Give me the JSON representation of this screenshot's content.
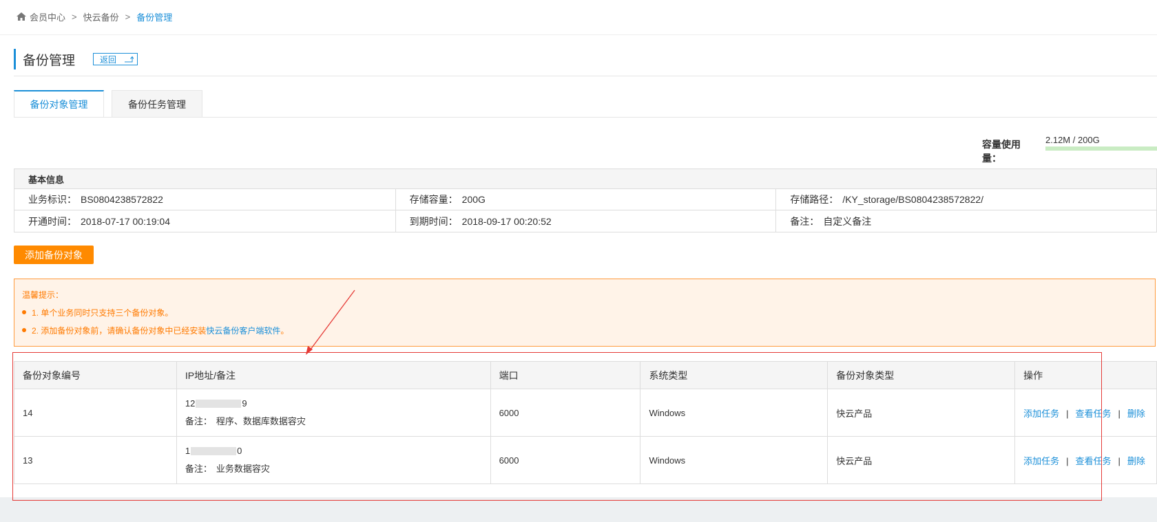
{
  "breadcrumb": {
    "items": [
      "会员中心",
      "快云备份",
      "备份管理"
    ],
    "separator": ">"
  },
  "page": {
    "title": "备份管理",
    "back_label": "返回"
  },
  "tabs": [
    {
      "label": "备份对象管理",
      "active": true
    },
    {
      "label": "备份任务管理",
      "active": false
    }
  ],
  "capacity": {
    "label": "容量使用量：",
    "value": "2.12M / 200G",
    "used_fraction": 0.0,
    "bar_color": "#c9ecc3"
  },
  "basic_info": {
    "header": "基本信息",
    "rows": [
      [
        {
          "key": "业务标识：",
          "value": "BS0804238572822"
        },
        {
          "key": "存储容量：",
          "value": "200G"
        },
        {
          "key": "存储路径：",
          "value": "/KY_storage/BS0804238572822/"
        }
      ],
      [
        {
          "key": "开通时间：",
          "value": "2018-07-17 00:19:04"
        },
        {
          "key": "到期时间：",
          "value": "2018-09-17 00:20:52"
        },
        {
          "key": "备注：",
          "value": "自定义备注"
        }
      ]
    ]
  },
  "add_button": {
    "label": "添加备份对象",
    "color": "#ff8a00"
  },
  "tips": {
    "title": "温馨提示：",
    "items": [
      {
        "text": "1. 单个业务同时只支持三个备份对象。",
        "link": ""
      },
      {
        "text": "2. 添加备份对象前，请确认备份对象中已经安装 ",
        "link": "快云备份客户端软件",
        "suffix": "。"
      }
    ]
  },
  "table": {
    "columns": [
      "备份对象编号",
      "IP地址/备注",
      "端口",
      "系统类型",
      "备份对象类型",
      "操作"
    ],
    "rows": [
      {
        "id": "14",
        "ip_prefix": "12",
        "ip_suffix": "9",
        "remark_label": "备注：",
        "remark": "程序、数据库数据容灾",
        "port": "6000",
        "os": "Windows",
        "type": "快云产品"
      },
      {
        "id": "13",
        "ip_prefix": "1",
        "ip_suffix": "0",
        "remark_label": "备注：",
        "remark": "业务数据容灾",
        "port": "6000",
        "os": "Windows",
        "type": "快云产品"
      }
    ],
    "actions": {
      "add_task": "添加任务",
      "view_task": "查看任务",
      "delete": "删除",
      "separator": "|"
    }
  },
  "colors": {
    "accent": "#1b8fd8",
    "warning": "#ff7a00",
    "annotation": "#e53935"
  }
}
